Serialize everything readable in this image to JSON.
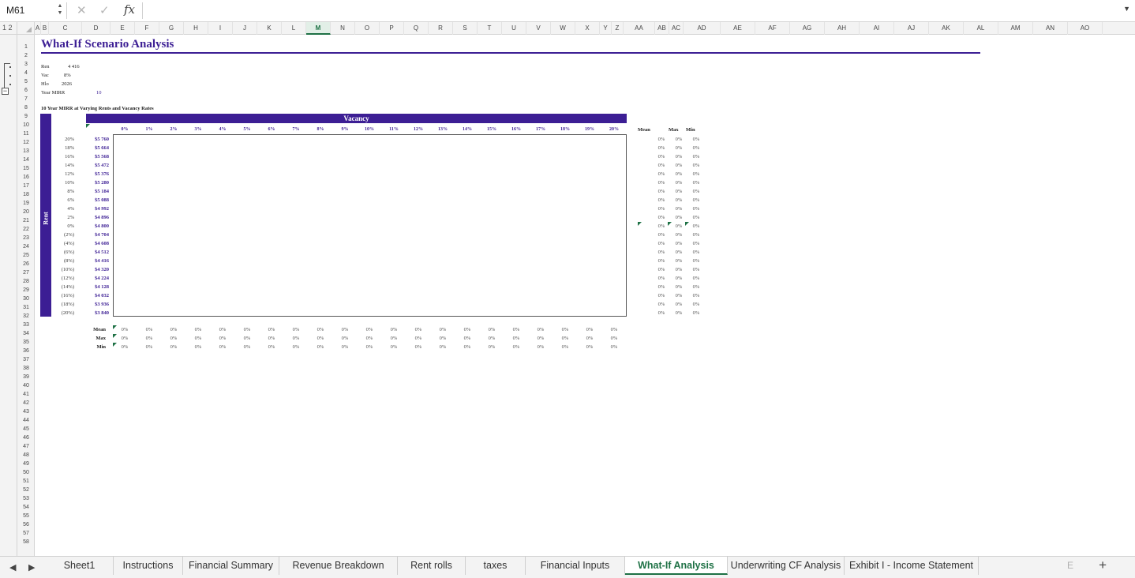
{
  "formula_bar": {
    "name_box": "M61",
    "cancel_icon": "close-icon",
    "confirm_icon": "check-icon",
    "fx_label": "fx",
    "formula": ""
  },
  "outline_levels": "1 2",
  "columns": [
    "A",
    "B",
    "C",
    "D",
    "E",
    "F",
    "G",
    "H",
    "I",
    "J",
    "K",
    "L",
    "M",
    "N",
    "O",
    "P",
    "Q",
    "R",
    "S",
    "T",
    "U",
    "V",
    "W",
    "X",
    "Y",
    "Z",
    "AA",
    "AB",
    "AC",
    "AD",
    "AE",
    "AF",
    "AG",
    "AH",
    "AI",
    "AJ",
    "AK",
    "AL",
    "AM",
    "AN",
    "AO"
  ],
  "active_column": "M",
  "rows": [
    "1",
    "2",
    "3",
    "4",
    "5",
    "6",
    "7",
    "8",
    "9",
    "10",
    "11",
    "12",
    "13",
    "14",
    "15",
    "16",
    "17",
    "18",
    "19",
    "20",
    "21",
    "22",
    "23",
    "24",
    "25",
    "26",
    "27",
    "28",
    "29",
    "30",
    "31",
    "32",
    "33",
    "34",
    "35",
    "36",
    "37",
    "38",
    "39",
    "40",
    "41",
    "42",
    "43",
    "44",
    "45",
    "46",
    "47",
    "48",
    "49",
    "50",
    "51",
    "52",
    "53",
    "54",
    "55",
    "56",
    "57",
    "58"
  ],
  "sheet": {
    "title": "What-If Scenario Analysis",
    "inputs": [
      {
        "label": "Ren",
        "value": "4 416"
      },
      {
        "label": "Vac",
        "value": "8%"
      },
      {
        "label": "Hlo",
        "value": "2026"
      },
      {
        "label": "Year MIRR",
        "value": "10"
      }
    ],
    "caption": "10 Year MIRR at Varying Rents and Vacancy Rates",
    "vacancy_title": "Vacancy",
    "rent_title": "Rent",
    "vacancy_headers": [
      "0%",
      "1%",
      "2%",
      "3%",
      "4%",
      "5%",
      "6%",
      "7%",
      "8%",
      "9%",
      "10%",
      "11%",
      "12%",
      "13%",
      "14%",
      "15%",
      "16%",
      "17%",
      "18%",
      "19%",
      "20%"
    ],
    "rent_pcts": [
      "20%",
      "18%",
      "16%",
      "14%",
      "12%",
      "10%",
      "8%",
      "6%",
      "4%",
      "2%",
      "0%",
      "(2%)",
      "(4%)",
      "(6%)",
      "(8%)",
      "(10%)",
      "(12%)",
      "(14%)",
      "(16%)",
      "(18%)",
      "(20%)"
    ],
    "rent_values": [
      "$5 760",
      "$5 664",
      "$5 568",
      "$5 472",
      "$5 376",
      "$5 280",
      "$5 184",
      "$5 088",
      "$4 992",
      "$4 896",
      "$4 800",
      "$4 704",
      "$4 608",
      "$4 512",
      "$4 416",
      "$4 320",
      "$4 224",
      "$4 128",
      "$4 032",
      "$3 936",
      "$3 840"
    ],
    "side_headers": [
      "Mean",
      "Max",
      "Min"
    ],
    "side_value": "0%",
    "bottom_labels": [
      "Mean",
      "Max",
      "Min"
    ],
    "bottom_value": "0%"
  },
  "tabs": [
    {
      "label": "Sheet1",
      "active": false
    },
    {
      "label": "Instructions",
      "active": false
    },
    {
      "label": "Financial Summary",
      "active": false
    },
    {
      "label": "Revenue Breakdown",
      "active": false
    },
    {
      "label": "Rent rolls",
      "active": false
    },
    {
      "label": "taxes",
      "active": false
    },
    {
      "label": "Financial Inputs",
      "active": false
    },
    {
      "label": "What-If Analysis",
      "active": true
    },
    {
      "label": "Underwriting CF Analysis",
      "active": false
    },
    {
      "label": "Exhibit I - Income Statement",
      "active": false
    }
  ],
  "tab_overflow": "E",
  "add_sheet": "+",
  "colors": {
    "accent": "#3c1e94",
    "active_green": "#1e7145"
  }
}
